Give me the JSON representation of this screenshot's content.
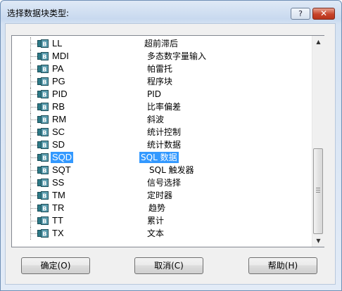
{
  "window": {
    "title": "选择数据块类型:"
  },
  "titlebar": {
    "help_label": "?",
    "close_label": "✕"
  },
  "list": {
    "items": [
      {
        "code": "LL",
        "desc": "超前滞后"
      },
      {
        "code": "MDI",
        "desc": "多态数字量输入"
      },
      {
        "code": "PA",
        "desc": "帕雷托"
      },
      {
        "code": "PG",
        "desc": "程序块"
      },
      {
        "code": "PID",
        "desc": "PID"
      },
      {
        "code": "RB",
        "desc": "比率偏差"
      },
      {
        "code": "RM",
        "desc": "斜波"
      },
      {
        "code": "SC",
        "desc": "统计控制"
      },
      {
        "code": "SD",
        "desc": "统计数据"
      },
      {
        "code": "SQD",
        "desc": "SQL 数据",
        "selected": true
      },
      {
        "code": "SQT",
        "desc": "SQL 触发器"
      },
      {
        "code": "SS",
        "desc": "信号选择"
      },
      {
        "code": "TM",
        "desc": "定时器"
      },
      {
        "code": "TR",
        "desc": "趋势"
      },
      {
        "code": "TT",
        "desc": "累计"
      },
      {
        "code": "TX",
        "desc": "文本"
      }
    ],
    "icon": "block-icon",
    "selection_color": "#3399ff"
  },
  "buttons": {
    "ok_label": "确定(O)",
    "cancel_label": "取消(C)",
    "help_label": "帮助(H)"
  }
}
